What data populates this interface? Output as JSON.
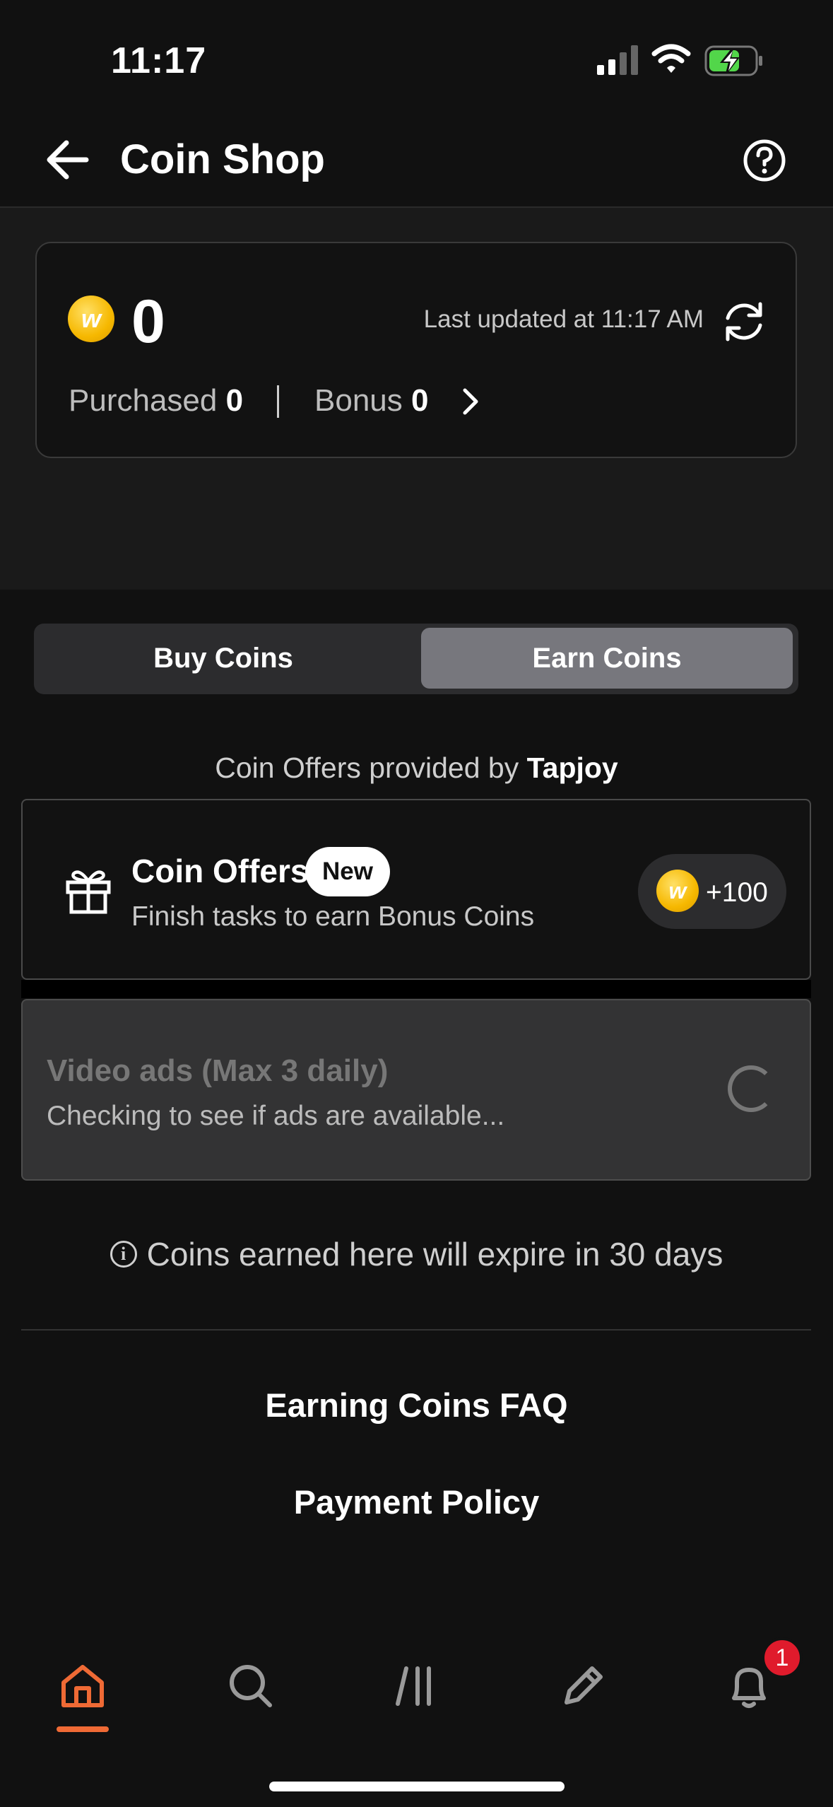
{
  "status_bar": {
    "time": "11:17"
  },
  "header": {
    "title": "Coin Shop"
  },
  "balance": {
    "total": "0",
    "last_updated": "Last updated at 11:17 AM",
    "purchased_label": "Purchased",
    "purchased_value": "0",
    "bonus_label": "Bonus",
    "bonus_value": "0"
  },
  "tabs": {
    "buy": "Buy Coins",
    "earn": "Earn Coins",
    "active": "earn"
  },
  "provider": {
    "prefix": "Coin Offers provided by",
    "name": "Tapjoy"
  },
  "coin_offers": {
    "title": "Coin Offers",
    "badge": "New",
    "subtitle": "Finish tasks to earn Bonus Coins",
    "reward": "+100"
  },
  "video_ads": {
    "title": "Video ads (Max 3 daily)",
    "subtitle": "Checking to see if ads are available..."
  },
  "expire_notice": "Coins earned here will expire in 30 days",
  "links": {
    "faq": "Earning Coins FAQ",
    "policy": "Payment Policy"
  },
  "bottom_nav": {
    "items": [
      "home-icon",
      "search-icon",
      "library-icon",
      "pencil-icon",
      "bell-icon"
    ],
    "active": "home-icon",
    "notification_count": "1"
  },
  "colors": {
    "accent": "#ef6a35",
    "coin": "#f6b800",
    "badge": "#e01b2c"
  }
}
